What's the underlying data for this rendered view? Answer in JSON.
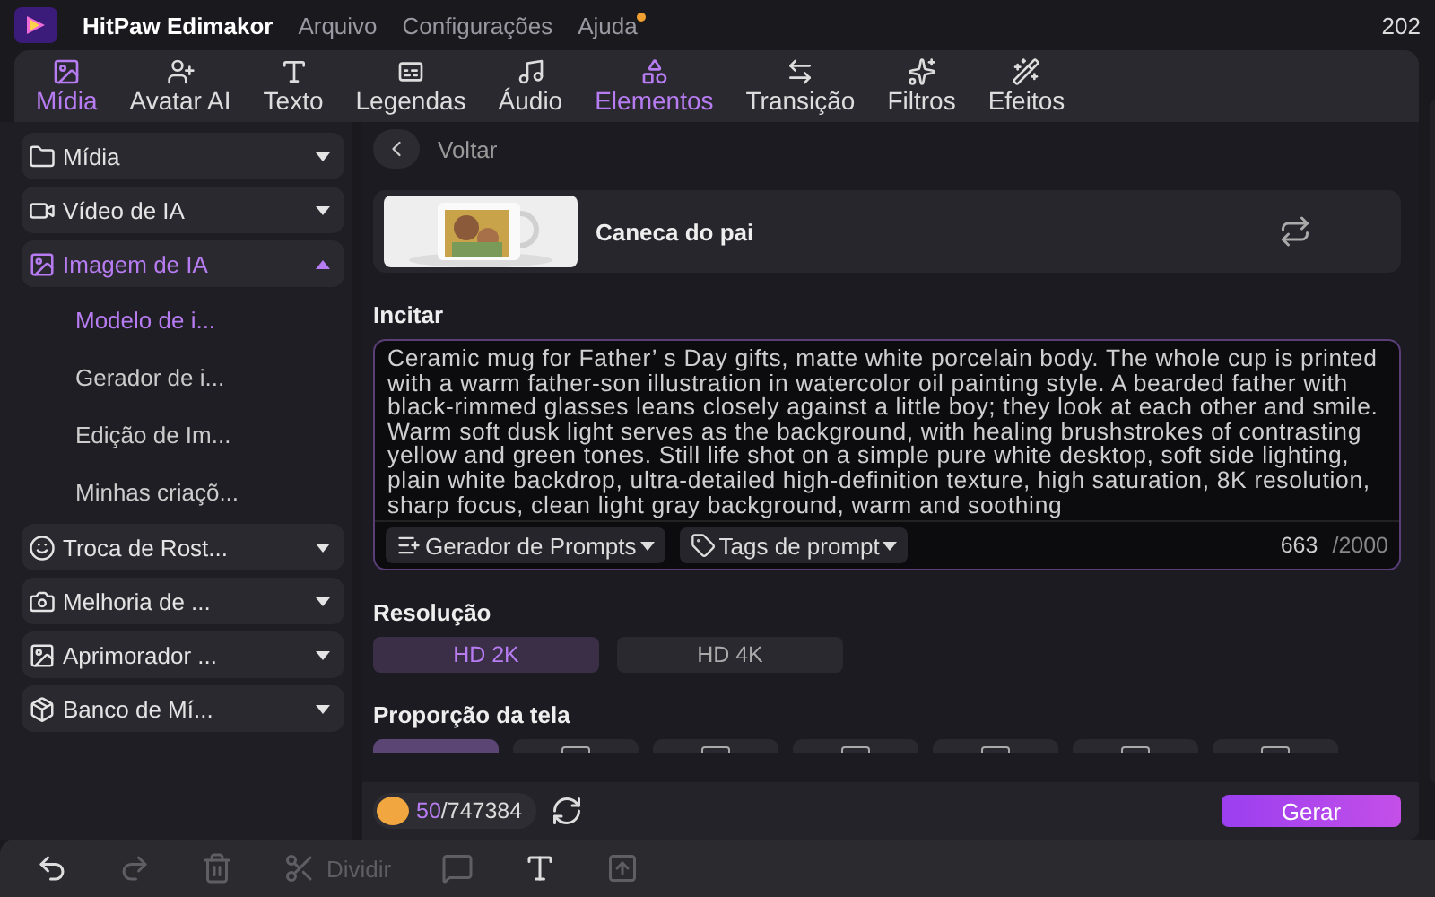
{
  "app": {
    "title": "HitPaw Edimakor",
    "menu": [
      {
        "label": "Arquivo",
        "badge": false
      },
      {
        "label": "Configurações",
        "badge": false
      },
      {
        "label": "Ajuda",
        "badge": true
      }
    ],
    "clock": "202"
  },
  "tabs": [
    {
      "label": "Mídia",
      "selected": true
    },
    {
      "label": "Avatar AI",
      "selected": false
    },
    {
      "label": "Texto",
      "selected": false
    },
    {
      "label": "Legendas",
      "selected": false
    },
    {
      "label": "Áudio",
      "selected": false
    },
    {
      "label": "Elementos",
      "selected": true
    },
    {
      "label": "Transição",
      "selected": false
    },
    {
      "label": "Filtros",
      "selected": false
    },
    {
      "label": "Efeitos",
      "selected": false
    }
  ],
  "sidebar": {
    "items": [
      {
        "label": "Mídia",
        "expanded": false,
        "selected": false
      },
      {
        "label": "Vídeo de IA",
        "expanded": false,
        "selected": false
      },
      {
        "label": "Imagem de IA",
        "expanded": true,
        "selected": true,
        "children": [
          {
            "label": "Modelo de i...",
            "selected": true
          },
          {
            "label": "Gerador de i...",
            "selected": false
          },
          {
            "label": "Edição de Im...",
            "selected": false
          },
          {
            "label": "Minhas criaçõ...",
            "selected": false
          }
        ]
      },
      {
        "label": "Troca de Rost...",
        "expanded": false,
        "selected": false
      },
      {
        "label": "Melhoria de ...",
        "expanded": false,
        "selected": false
      },
      {
        "label": "Aprimorador ...",
        "expanded": false,
        "selected": false
      },
      {
        "label": "Banco de Mí...",
        "expanded": false,
        "selected": false
      }
    ]
  },
  "panel": {
    "back": "Voltar",
    "template": {
      "name": "Caneca do pai"
    },
    "prompt": {
      "label": "Incitar",
      "value": "Ceramic mug for Father’ s Day gifts, matte white porcelain body. The whole cup is printed with a warm father-son illustration in watercolor oil painting style. A bearded father with black-rimmed glasses leans closely against a little boy; they look at each other and smile. Warm soft dusk light serves as the background, with healing brushstrokes of contrasting yellow and green tones. Still life shot on a simple pure white desktop, soft side lighting, plain white backdrop, ultra-detailed high-definition texture, high saturation, 8K resolution, sharp focus, clean light gray background, warm and soothing",
      "tools": [
        "Gerador de Prompts",
        "Tags de prompt"
      ],
      "count": "663",
      "limit": "/2000"
    },
    "resolution": {
      "label": "Resolução",
      "options": [
        {
          "label": "HD 2K",
          "selected": true
        },
        {
          "label": "HD 4K",
          "selected": false
        }
      ]
    },
    "aspect": {
      "label": "Proporção da tela",
      "options": [
        {
          "selected": true
        },
        {
          "selected": false
        },
        {
          "selected": false
        },
        {
          "selected": false
        },
        {
          "selected": false
        },
        {
          "selected": false
        },
        {
          "selected": false
        }
      ]
    },
    "credits": {
      "used": "50",
      "total": "/747384"
    },
    "generate": "Gerar"
  },
  "toolbar": [
    {
      "disabled": false
    },
    {
      "disabled": true
    },
    {
      "disabled": true
    },
    {
      "label": "Dividir",
      "disabled": true
    },
    {
      "disabled": true
    },
    {
      "disabled": false
    },
    {
      "disabled": true
    }
  ]
}
